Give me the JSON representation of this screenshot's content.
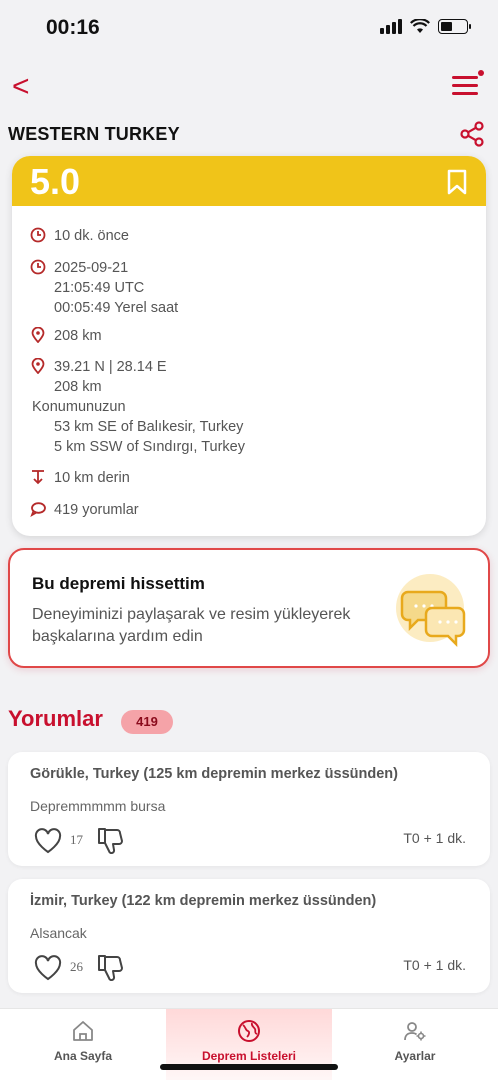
{
  "status": {
    "time": "00:16"
  },
  "header": {
    "back_label": "<",
    "region": "WESTERN TURKEY"
  },
  "quake": {
    "magnitude": "5.0",
    "ago": "10 dk. önce",
    "date": "2025-09-21",
    "utc": "21:05:49 UTC",
    "local": "00:05:49 Yerel saat",
    "distance": "208 km",
    "coords": "39.21 N | 28.14 E",
    "coords_distance": "208 km",
    "location_label": "Konumunuzun",
    "near_1": "53 km SE of Balıkesir, Turkey",
    "near_2": "5 km SSW of Sındırgı, Turkey",
    "depth": "10 km derin",
    "comments": "419 yorumlar"
  },
  "felt": {
    "title": "Bu depremi hissettim",
    "subtitle": "Deneyiminizi paylaşarak ve resim yükleyerek başkalarına yardım edin"
  },
  "comments_section": {
    "title": "Yorumlar",
    "count": "419"
  },
  "comments": [
    {
      "location": "Görükle, Turkey (125 km depremin merkez üssünden)",
      "text": "Deprem​mmmm bursa",
      "likes": "17",
      "time": "T0 + 1 dk."
    },
    {
      "location": "İzmir, Turkey (122 km depremin merkez üssünden)",
      "text": "Alsancak",
      "likes": "26",
      "time": "T0 + 1 dk."
    }
  ],
  "nav": {
    "home": "Ana Sayfa",
    "lists": "Deprem Listeleri",
    "settings": "Ayarlar"
  },
  "colors": {
    "accent": "#c8102e",
    "magnitude_bg": "#f0c419",
    "felt_border": "#e04848"
  }
}
